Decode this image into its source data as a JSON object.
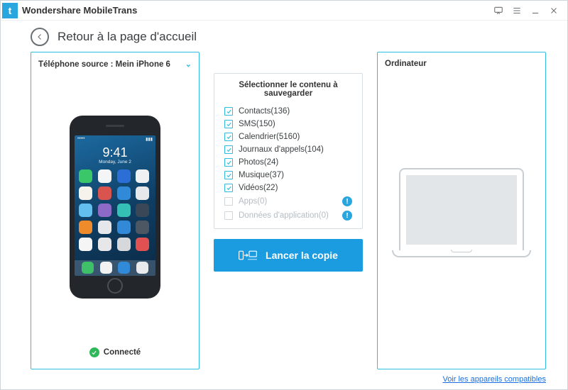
{
  "titlebar": {
    "app_name": "Wondershare MobileTrans"
  },
  "header": {
    "page_title": "Retour à la page d'accueil"
  },
  "source": {
    "label_prefix": "Téléphone source : ",
    "device_name": "Mein iPhone 6",
    "status_label": "Connecté",
    "screen": {
      "time": "9:41",
      "date": "Monday, June 2"
    }
  },
  "content": {
    "title": "Sélectionner le contenu à sauvegarder",
    "items": [
      {
        "label": "Contacts",
        "count": 136,
        "checked": true,
        "enabled": true,
        "info": false
      },
      {
        "label": "SMS",
        "count": 150,
        "checked": true,
        "enabled": true,
        "info": false
      },
      {
        "label": "Calendrier",
        "count": 5160,
        "checked": true,
        "enabled": true,
        "info": false
      },
      {
        "label": "Journaux d'appels",
        "count": 104,
        "checked": true,
        "enabled": true,
        "info": false
      },
      {
        "label": "Photos",
        "count": 24,
        "checked": true,
        "enabled": true,
        "info": false
      },
      {
        "label": "Musique",
        "count": 37,
        "checked": true,
        "enabled": true,
        "info": false
      },
      {
        "label": "Vidéos",
        "count": 22,
        "checked": true,
        "enabled": true,
        "info": false
      },
      {
        "label": "Apps",
        "count": 0,
        "checked": false,
        "enabled": false,
        "info": true
      },
      {
        "label": "Données d'application",
        "count": 0,
        "checked": false,
        "enabled": false,
        "info": true
      }
    ]
  },
  "action": {
    "launch_label": "Lancer la copie"
  },
  "destination": {
    "label": "Ordinateur"
  },
  "footer": {
    "compat_link": "Voir les appareils compatibles"
  },
  "app_colors": [
    "#39c76a",
    "#f4f5f7",
    "#2a6ed6",
    "#f0f1f3",
    "#f6f2ec",
    "#d9534f",
    "#318ad8",
    "#e7e8ea",
    "#63c0ee",
    "#8e6ac7",
    "#34c0b5",
    "#3a4756",
    "#f08b2c",
    "#e6e7ea",
    "#3289d8",
    "#4d5663",
    "#f5f5f5",
    "#e7e7e9",
    "#d6d8db",
    "#e25151"
  ],
  "dock_colors": [
    "#3fbf67",
    "#f2f2f2",
    "#318ad8",
    "#e9eaec"
  ]
}
